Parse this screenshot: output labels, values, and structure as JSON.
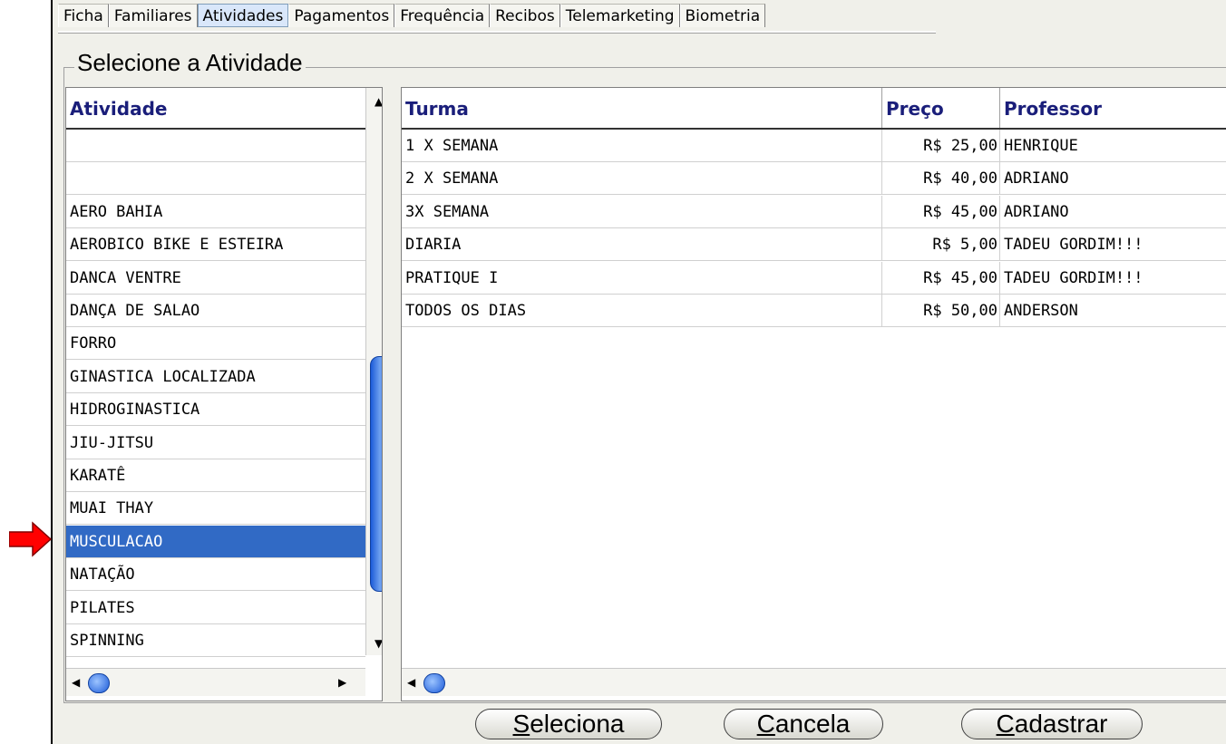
{
  "tabs": [
    "Ficha",
    "Familiares",
    "Atividades",
    "Pagamentos",
    "Frequência",
    "Recibos",
    "Telemarketing",
    "Biometria"
  ],
  "active_tab": "Atividades",
  "group_title": "Selecione a Atividade",
  "activities": {
    "header": "Atividade",
    "items": [
      "",
      "",
      "AERO BAHIA",
      "AEROBICO BIKE E ESTEIRA",
      "DANCA VENTRE",
      "DANÇA DE SALAO",
      "FORRO",
      "GINASTICA LOCALIZADA",
      "HIDROGINASTICA",
      "JIU-JITSU",
      "KARATÊ",
      "MUAI THAY",
      "MUSCULACAO",
      "NATAÇÃO",
      "PILATES",
      "SPINNING"
    ],
    "selected": "MUSCULACAO"
  },
  "classes": {
    "headers": {
      "turma": "Turma",
      "preco": "Preço",
      "professor": "Professor"
    },
    "rows": [
      {
        "turma": "1 X SEMANA",
        "preco": "R$ 25,00",
        "professor": "HENRIQUE"
      },
      {
        "turma": "2 X SEMANA",
        "preco": "R$ 40,00",
        "professor": "ADRIANO"
      },
      {
        "turma": "3X SEMANA",
        "preco": "R$ 45,00",
        "professor": "ADRIANO"
      },
      {
        "turma": "DIARIA",
        "preco": "R$ 5,00",
        "professor": "TADEU  GORDIM!!!"
      },
      {
        "turma": "PRATIQUE I",
        "preco": "R$ 45,00",
        "professor": "TADEU  GORDIM!!!"
      },
      {
        "turma": "TODOS OS DIAS",
        "preco": "R$ 50,00",
        "professor": "ANDERSON"
      }
    ]
  },
  "buttons": {
    "seleciona": {
      "accel": "S",
      "rest": "eleciona"
    },
    "cancela": {
      "accel": "C",
      "rest": "ancela"
    },
    "cadastrar": {
      "accel": "C",
      "rest": "adastrar"
    }
  },
  "colors": {
    "selection": "#316ac5",
    "header_text": "#1a1e7a",
    "arrow": "#ff0000"
  }
}
